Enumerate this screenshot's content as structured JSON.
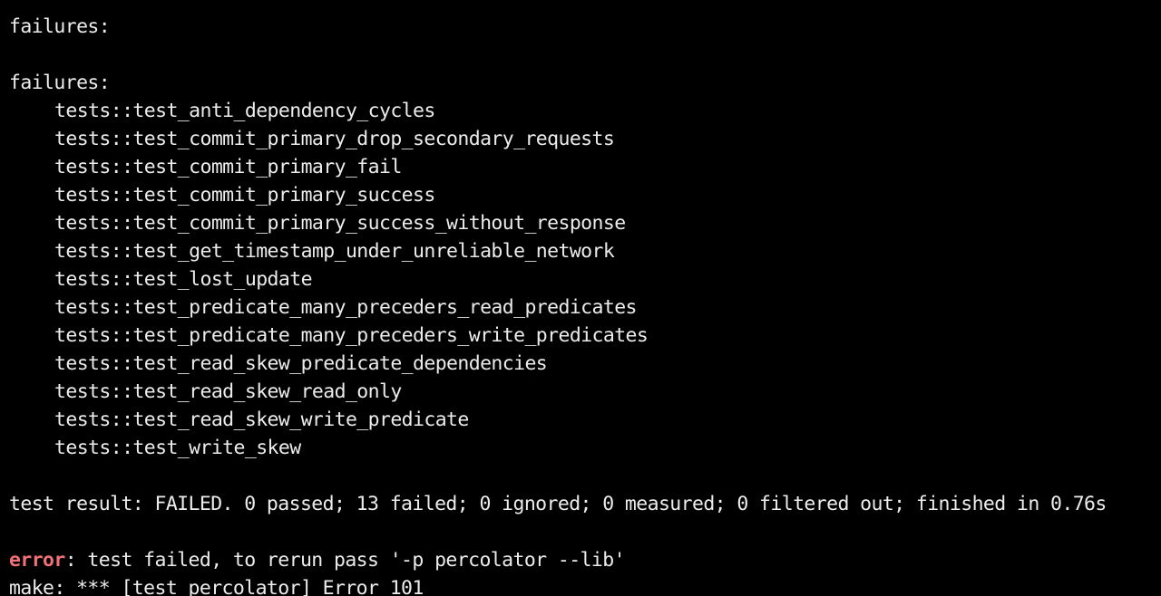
{
  "terminal": {
    "header_1": "failures:",
    "header_2": "failures:",
    "failures": [
      "tests::test_anti_dependency_cycles",
      "tests::test_commit_primary_drop_secondary_requests",
      "tests::test_commit_primary_fail",
      "tests::test_commit_primary_success",
      "tests::test_commit_primary_success_without_response",
      "tests::test_get_timestamp_under_unreliable_network",
      "tests::test_lost_update",
      "tests::test_predicate_many_preceders_read_predicates",
      "tests::test_predicate_many_preceders_write_predicates",
      "tests::test_read_skew_predicate_dependencies",
      "tests::test_read_skew_read_only",
      "tests::test_read_skew_write_predicate",
      "tests::test_write_skew"
    ],
    "result_line": "test result: FAILED. 0 passed; 13 failed; 0 ignored; 0 measured; 0 filtered out; finished in 0.76s",
    "error_label": "error",
    "error_message": ": test failed, to rerun pass '-p percolator --lib'",
    "make_line": "make: *** [test_percolator] Error 101",
    "colors": {
      "background": "#000000",
      "text": "#ececec",
      "error": "#f07178"
    }
  }
}
